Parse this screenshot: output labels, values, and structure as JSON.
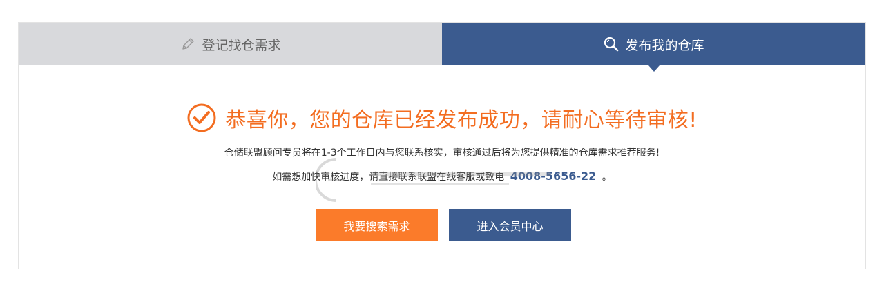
{
  "tabs": [
    {
      "label": "登记找仓需求",
      "icon": "pencil-icon",
      "active": false
    },
    {
      "label": "发布我的仓库",
      "icon": "search-icon",
      "active": true
    }
  ],
  "message": {
    "headline": "恭喜你，您的仓库已经发布成功，请耐心等待审核!",
    "line1": "仓储联盟顾问专员将在1-3个工作日内与您联系核实，审核通过后将为您提供精准的仓库需求推荐服务!",
    "line2_prefix": "如需想加快审核进度，请直接联系联盟在线客服或致电",
    "phone": "4008-5656-22",
    "line2_suffix": "。"
  },
  "buttons": {
    "search_demand": "我要搜索需求",
    "member_center": "进入会员中心"
  },
  "colors": {
    "accent_orange": "#f36d21",
    "brand_blue": "#3b5b8f",
    "inactive_tab": "#d8d9dc"
  }
}
